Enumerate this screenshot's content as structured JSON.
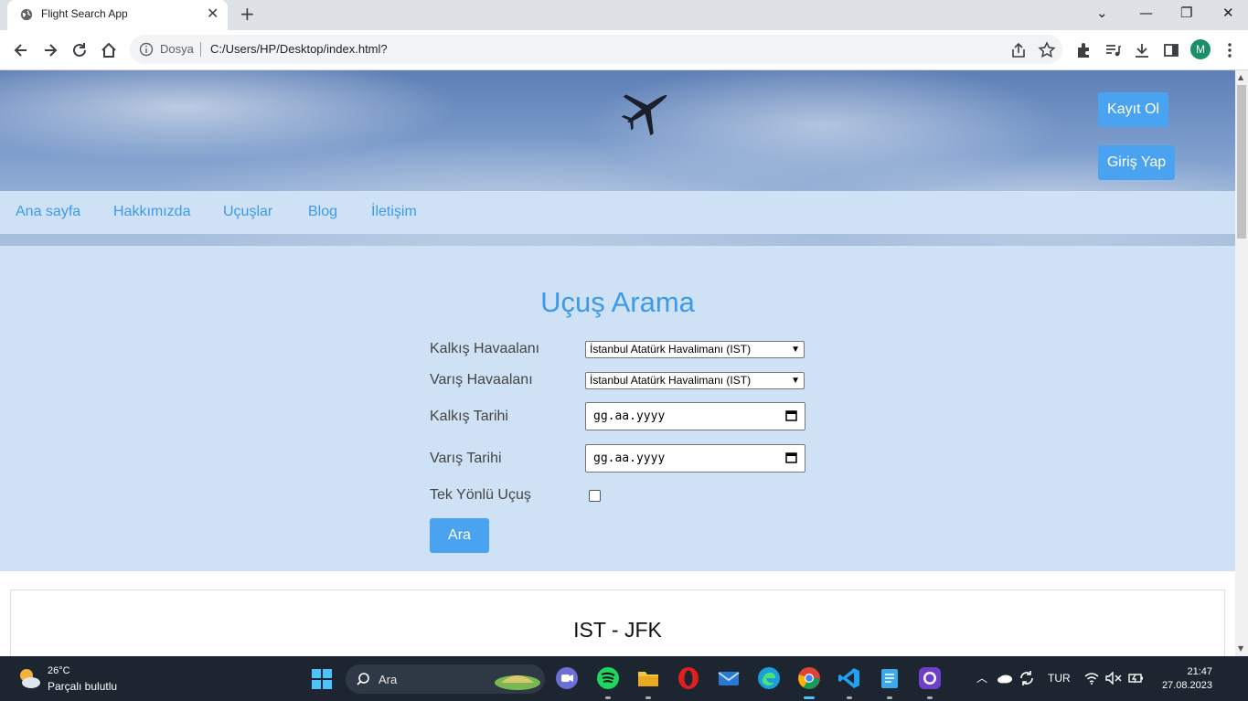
{
  "browser": {
    "tab_title": "Flight Search App",
    "tab_close": "✕",
    "new_tab": "+",
    "omnibox_prefix": "Dosya",
    "url": "C:/Users/HP/Desktop/index.html?",
    "profile_initial": "M"
  },
  "header": {
    "register_label": "Kayıt Ol",
    "login_label": "Giriş Yap"
  },
  "nav": {
    "items": [
      "Ana sayfa",
      "Hakkımızda",
      "Uçuşlar",
      "Blog",
      "İletişim"
    ]
  },
  "search": {
    "title": "Uçuş Arama",
    "departure_airport_label": "Kalkış Havaalanı",
    "departure_airport_value": "İstanbul Atatürk Havalimanı (IST)",
    "arrival_airport_label": "Varış Havaalanı",
    "arrival_airport_value": "İstanbul Atatürk Havalimanı (IST)",
    "departure_date_label": "Kalkış Tarihi",
    "departure_date_placeholder": "gg.aa.yyyy",
    "arrival_date_label": "Varış Tarihi",
    "arrival_date_placeholder": "gg.aa.yyyy",
    "one_way_label": "Tek Yönlü Uçuş",
    "one_way_checked": false,
    "submit_label": "Ara"
  },
  "result": {
    "route": "IST - JFK"
  },
  "taskbar": {
    "temperature": "26°C",
    "weather": "Parçalı bulutlu",
    "search_placeholder": "Ara",
    "language": "TUR",
    "time": "21:47",
    "date": "27.08.2023"
  },
  "colors": {
    "accent": "#4aa3f0",
    "nav_bg": "#cfe2f5",
    "taskbar_bg": "#1c2530"
  }
}
